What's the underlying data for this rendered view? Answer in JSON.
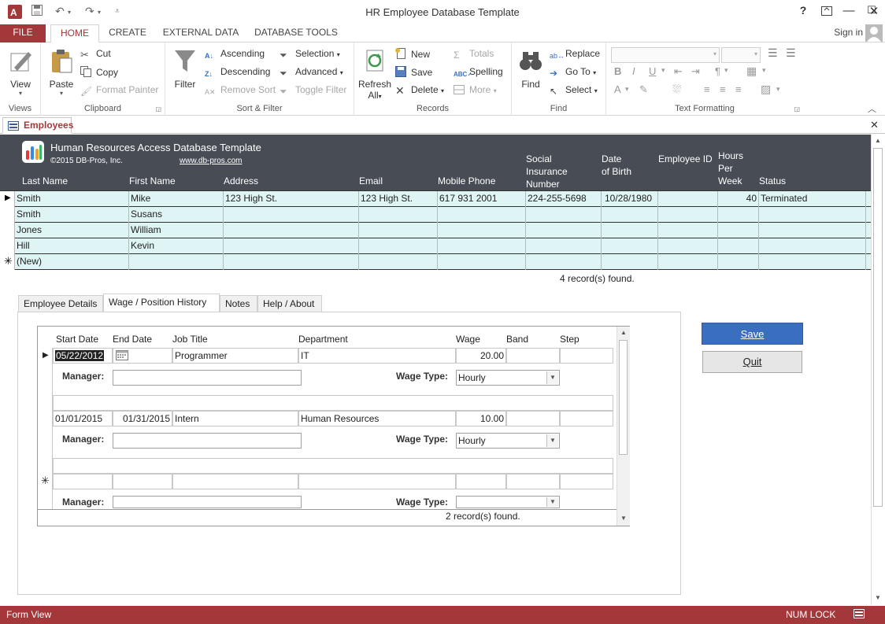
{
  "window": {
    "title": "HR Employee Database Template",
    "help": "?",
    "sign_in": "Sign in"
  },
  "ribbon_tabs": [
    "FILE",
    "HOME",
    "CREATE",
    "EXTERNAL DATA",
    "DATABASE TOOLS"
  ],
  "ribbon": {
    "views": {
      "view": "View",
      "label": "Views"
    },
    "clipboard": {
      "paste": "Paste",
      "cut": "Cut",
      "copy": "Copy",
      "format_painter": "Format Painter",
      "label": "Clipboard"
    },
    "sort_filter": {
      "filter": "Filter",
      "ascending": "Ascending",
      "descending": "Descending",
      "remove_sort": "Remove Sort",
      "selection": "Selection",
      "advanced": "Advanced",
      "toggle_filter": "Toggle Filter",
      "label": "Sort & Filter"
    },
    "records": {
      "refresh": "Refresh",
      "refresh_all": "All",
      "new": "New",
      "save": "Save",
      "delete": "Delete",
      "totals": "Totals",
      "spelling": "Spelling",
      "more": "More",
      "label": "Records"
    },
    "find": {
      "find": "Find",
      "replace": "Replace",
      "goto": "Go To",
      "select": "Select",
      "label": "Find"
    },
    "text_formatting": {
      "label": "Text Formatting"
    }
  },
  "object_tab": "Employees",
  "header": {
    "title": "Human Resources Access Database Template",
    "copyright": "©2015 DB-Pros, Inc.",
    "link": "www.db-pros.com"
  },
  "columns": {
    "last_name": "Last Name",
    "first_name": "First Name",
    "address": "Address",
    "email": "Email",
    "mobile": "Mobile Phone",
    "sin_1": "Social",
    "sin_2": "Insurance",
    "sin_3": "Number",
    "dob_1": "Date",
    "dob_2": "of Birth",
    "emp_id": "Employee ID",
    "hours_1": "Hours",
    "hours_2": "Per",
    "hours_3": "Week",
    "status": "Status"
  },
  "employees": [
    {
      "last": "Smith",
      "first": "Mike",
      "address": "123 High St.",
      "email": "123 High St.",
      "mobile": "617 931 2001",
      "sin": "224-255-5698",
      "dob": "10/28/1980",
      "emp_id": "",
      "hours": "40",
      "status": "Terminated"
    },
    {
      "last": "Smith",
      "first": "Susans",
      "address": "",
      "email": "",
      "mobile": "",
      "sin": "",
      "dob": "",
      "emp_id": "",
      "hours": "",
      "status": ""
    },
    {
      "last": "Jones",
      "first": "William",
      "address": "",
      "email": "",
      "mobile": "",
      "sin": "",
      "dob": "",
      "emp_id": "",
      "hours": "",
      "status": ""
    },
    {
      "last": "Hill",
      "first": "Kevin",
      "address": "",
      "email": "",
      "mobile": "",
      "sin": "",
      "dob": "",
      "emp_id": "",
      "hours": "",
      "status": ""
    }
  ],
  "new_row": "(New)",
  "records_found": {
    "count": "4",
    "text": "record(s) found."
  },
  "form_tabs": [
    "Employee Details",
    "Wage / Position History",
    "Notes",
    "Help / About"
  ],
  "subform": {
    "headers": {
      "start": "Start Date",
      "end": "End Date",
      "job": "Job Title",
      "dept": "Department",
      "wage": "Wage",
      "band": "Band",
      "step": "Step"
    },
    "manager_label": "Manager:",
    "wage_type_label": "Wage Type:",
    "records": [
      {
        "start": "05/22/2012",
        "end": "",
        "job": "Programmer",
        "dept": "IT",
        "wage": "20.00",
        "band": "",
        "step": "",
        "manager": "",
        "wage_type": "Hourly"
      },
      {
        "start": "01/01/2015",
        "end": "01/31/2015",
        "job": "Intern",
        "dept": "Human Resources",
        "wage": "10.00",
        "band": "",
        "step": "",
        "manager": "",
        "wage_type": "Hourly"
      }
    ],
    "records_found": {
      "count": "2",
      "text": "record(s) found."
    }
  },
  "buttons": {
    "save": "Save",
    "quit": "Quit"
  },
  "status": {
    "left": "Form View",
    "num_lock": "NUM LOCK"
  },
  "colors": {
    "accent": "#a4373a",
    "header_bg": "#474c55",
    "row_bg": "#dff5f5",
    "save_btn": "#3a6fc0"
  }
}
